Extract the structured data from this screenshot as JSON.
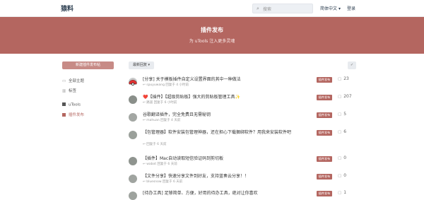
{
  "header": {
    "logo": "猿料",
    "search_placeholder": "搜索",
    "lang": "简体中文",
    "login": "登录"
  },
  "banner": {
    "title": "插件发布",
    "subtitle": "为 uTools 注入更多灵魂",
    "color": "#b46660"
  },
  "sidebar": {
    "new_button": "新建插件发布帖",
    "items": [
      {
        "label": "全部主题",
        "icon": "comments-icon"
      },
      {
        "label": "标签",
        "icon": "tags-icon"
      },
      {
        "label": "uTools",
        "color": "#555555"
      },
      {
        "label": "插件发布",
        "color": "#b46660"
      }
    ]
  },
  "toolbar": {
    "sort_label": "最新回复",
    "mark_icon": "check-icon"
  },
  "discussions": [
    {
      "title": "[分享] 关于模板插件自定义设置界面的其中一种做法",
      "author": "spuyuwang",
      "time": "回复于 4 小时前",
      "tag": "插件发布",
      "replies": "23",
      "avatar": "pokeball"
    },
    {
      "title_prefix": "❤️",
      "title": "【插件】【超级剪贴板】强大的剪贴板管理工具",
      "title_suffix": "✨",
      "author": "路遥",
      "time": "回复于 6 小时前",
      "tag": "插件发布",
      "replies": "207",
      "avatar": "person"
    },
    {
      "title": "谷歌翻译插件，完全免费且无需秘钥",
      "author": "mahuan",
      "time": "回复于 4 天前",
      "tag": "插件发布",
      "replies": "5",
      "avatar": "person"
    },
    {
      "title": "【包管理器】软件安装包管理神器，还在担心下载捆绑软件？用我来安装软件吧",
      "author": "",
      "time": "回复于 6 天前",
      "tag": "插件发布",
      "replies": "6",
      "avatar": "person"
    },
    {
      "title": "【插件】Mac自动读取短信验证码到剪切板",
      "author": "wabot",
      "time": "回复于 6 天前",
      "tag": "插件发布",
      "replies": "0",
      "avatar": "person"
    },
    {
      "title": "【文件分享】快速分享文件到好友，支持蓝奏云分享！！",
      "author": "bluesnow",
      "time": "回复于 6 天前",
      "tag": "插件发布",
      "replies": "0",
      "avatar": "person"
    },
    {
      "title": "[待办工具] 足够简单、方便，好用的待办工具，绝对让你喜欢",
      "author": "",
      "time": "回复于 7 天前",
      "tag": "插件发布",
      "replies": "1",
      "avatar": "person"
    }
  ]
}
